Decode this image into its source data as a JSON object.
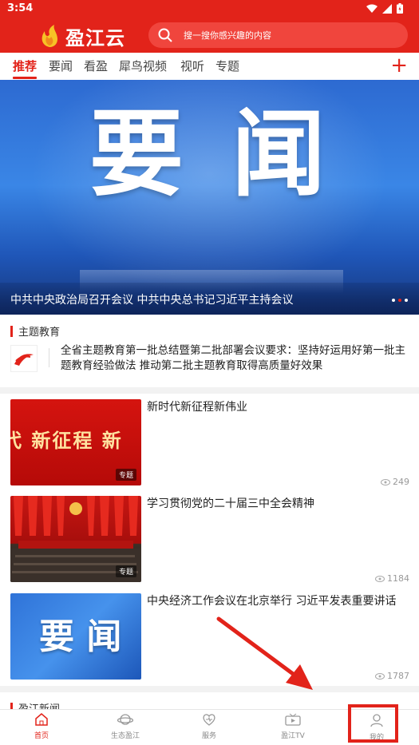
{
  "status_bar": {
    "time": "3:54",
    "icons": [
      "wifi-icon",
      "signal-icon",
      "battery-icon"
    ]
  },
  "header": {
    "app_name": "盈江云",
    "search_placeholder": "搜一搜你感兴趣的内容"
  },
  "tabs": [
    {
      "label": "推荐",
      "active": true
    },
    {
      "label": "要闻"
    },
    {
      "label": "看盈"
    },
    {
      "label": "犀鸟视频"
    },
    {
      "label": "视听"
    },
    {
      "label": "专题"
    }
  ],
  "banner": {
    "big_text": [
      "要",
      "闻"
    ],
    "caption": "中共中央政治局召开会议  中共中央总书记习近平主持会议",
    "slide_count": 3
  },
  "topic_section": {
    "title": "主题教育",
    "headline": "全省主题教育第一批总结暨第二批部署会议要求：坚持好运用好第一批主题教育经验做法  推动第二批主题教育取得高质量好效果"
  },
  "news": [
    {
      "title": "新时代新征程新伟业",
      "views": "249",
      "tag": "专题",
      "thumb_text": "代 新征程 新"
    },
    {
      "title": "学习贯彻党的二十届三中全会精神",
      "views": "1184",
      "tag": "专题"
    },
    {
      "title": "中央经济工作会议在北京举行  习近平发表重要讲话",
      "views": "1787",
      "thumb_text": "要 闻"
    }
  ],
  "next_section": {
    "title": "盈江新闻"
  },
  "bottom_nav": [
    {
      "label": "首页",
      "icon": "home-icon",
      "active": true
    },
    {
      "label": "生态盈江",
      "icon": "planet-icon"
    },
    {
      "label": "服务",
      "icon": "heart-service-icon"
    },
    {
      "label": "盈江TV",
      "icon": "tv-icon"
    },
    {
      "label": "我的",
      "icon": "user-icon"
    }
  ],
  "colors": {
    "brand": "#e2231a",
    "text": "#222222",
    "muted": "#999999"
  }
}
